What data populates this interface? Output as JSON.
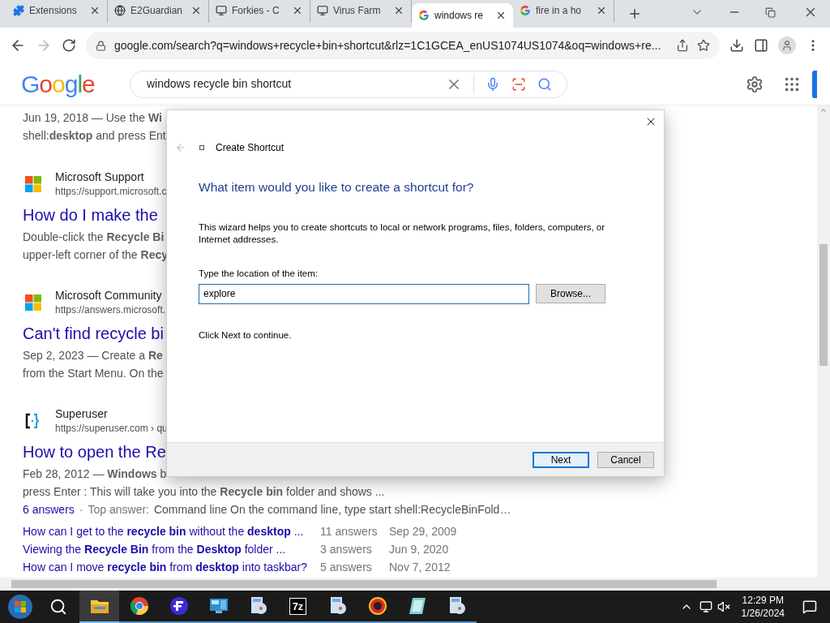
{
  "tabs": [
    {
      "kind": "extension",
      "label": "Extensions",
      "selected": false
    },
    {
      "kind": "web",
      "label": "E2Guardian",
      "selected": false
    },
    {
      "kind": "server",
      "label": "Forkies - C",
      "selected": false
    },
    {
      "kind": "server",
      "label": "Virus Farm",
      "selected": false
    },
    {
      "kind": "search",
      "label": "windows re",
      "selected": true
    },
    {
      "kind": "search",
      "label": "fire in a ho",
      "selected": false
    }
  ],
  "address": "google.com/search?q=windows+recycle+bin+shortcut&rlz=1C1GCEA_enUS1074US1074&oq=windows+re...",
  "logo": [
    {
      "text": "G",
      "color": "#4285f4"
    },
    {
      "text": "o",
      "color": "#ea4335"
    },
    {
      "text": "o",
      "color": "#fbbc05"
    },
    {
      "text": "g",
      "color": "#4285f4"
    },
    {
      "text": "l",
      "color": "#34a853"
    },
    {
      "text": "e",
      "color": "#ea4335"
    }
  ],
  "search_query": "windows recycle bin shortcut",
  "results": [
    {
      "snippet": [
        "Jun 19, 2018 — Use the **Wi**",
        "shell:**desktop** and press Ent"
      ]
    },
    {
      "kind": "windows",
      "site": "Microsoft Support",
      "url": "https://support.microsoft.c",
      "title": "How do I make the",
      "snippet": [
        "Double-click the **Recycle Bi**",
        "upper-left corner of the **Recy**"
      ]
    },
    {
      "kind": "windows",
      "site": "Microsoft Community",
      "url": "https://answers.microsoft.",
      "title": "Can't find recycle bi",
      "snippet": [
        "Sep 2, 2023 — Create a **Re**",
        "from the Start Menu. On the"
      ]
    },
    {
      "kind": "qa",
      "site": "Superuser",
      "url": "https://superuser.com › qu",
      "title": "How to open the Re",
      "snippet": [
        "Feb 28, 2012 — **Windows** b",
        "press Enter : This will take you into the **Recycle bin** folder and shows ..."
      ],
      "answers_link": "6 answers",
      "separator": "·",
      "top_answer_label": "Top answer:",
      "top_answer": "Command line On the command line, type start shell:RecycleBinFold…",
      "related": [
        {
          "question": "How can I get to the **recycle bin** without the **desktop** ...",
          "answers": "11 answers",
          "date": "Sep 29, 2009"
        },
        {
          "question": "Viewing the **Recycle Bin** from the **Desktop** folder ...",
          "answers": "3 answers",
          "date": "Jun 9, 2020"
        },
        {
          "question": "How can I move **recycle bin** from **desktop** into taskbar?",
          "answers": "5 answers",
          "date": "Nov 7, 2012"
        }
      ]
    }
  ],
  "dialog": {
    "title": "Create Shortcut",
    "heading": "What item would you like to create a shortcut for?",
    "description": "This wizard helps you to create shortcuts to local or network programs, files, folders, computers, or Internet addresses.",
    "field_label": "Type the location of the item:",
    "field_value": "explore",
    "browse": "Browse...",
    "hint": "Click Next to continue.",
    "next": "Next",
    "cancel": "Cancel"
  },
  "taskbar": {
    "apps": [
      {
        "kind": "folder",
        "active": true
      },
      {
        "kind": "chrome",
        "active": false
      },
      {
        "kind": "fapp",
        "active": false
      },
      {
        "kind": "monitor",
        "active": false
      },
      {
        "kind": "disc",
        "active": false
      },
      {
        "kind": "archive",
        "label": "7z",
        "active": false
      },
      {
        "kind": "disc",
        "active": false
      },
      {
        "kind": "ring",
        "active": false
      },
      {
        "kind": "notebook",
        "active": false
      },
      {
        "kind": "disc",
        "active": false
      }
    ],
    "time": "12:29 PM",
    "date": "1/26/2024"
  }
}
